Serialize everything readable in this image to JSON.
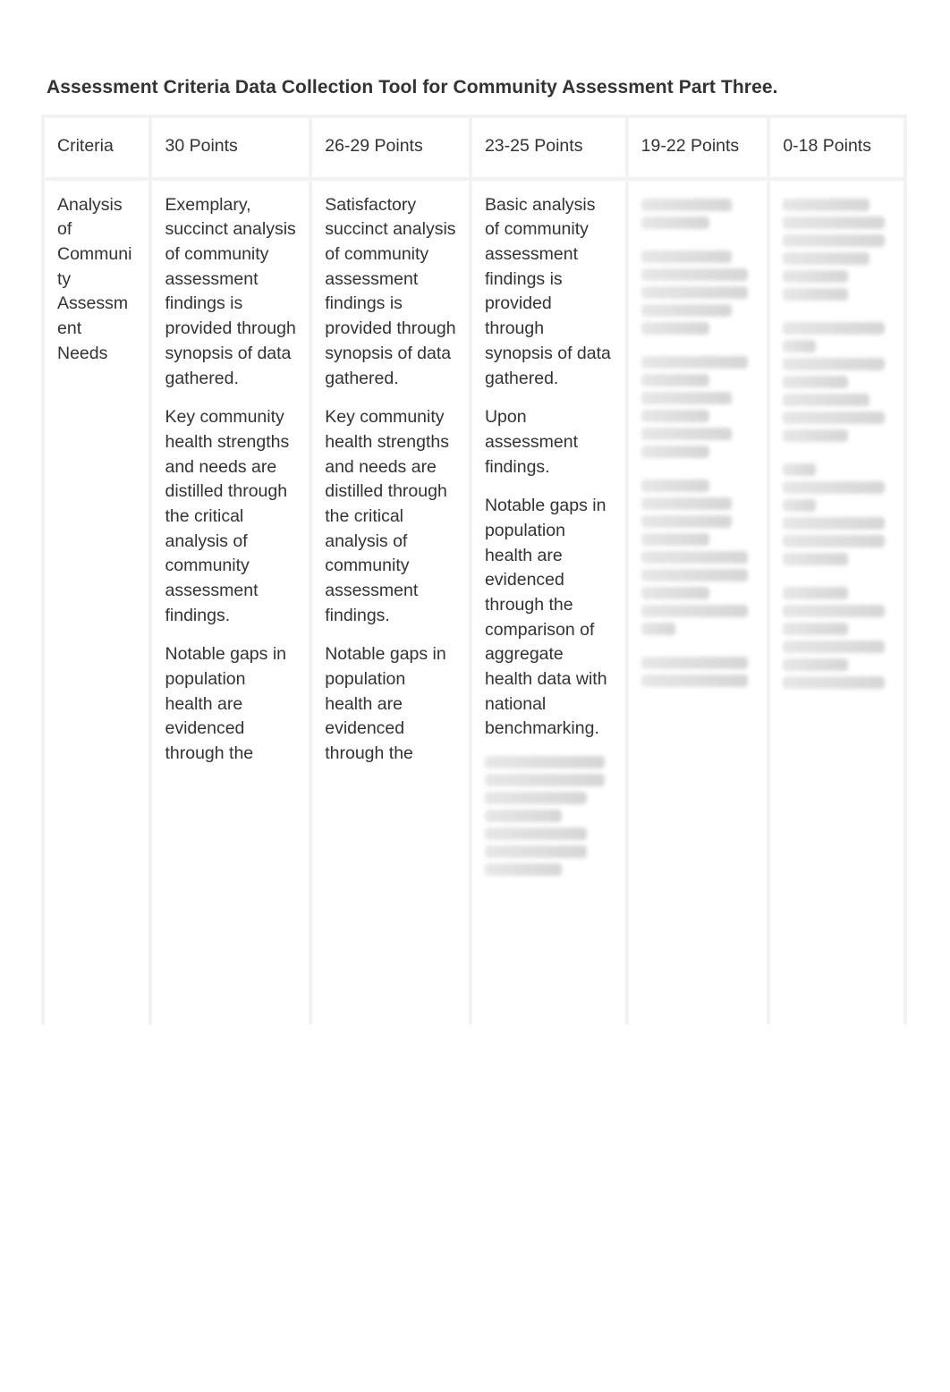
{
  "title": "Assessment Criteria  Data Collection Tool for Community Assessment Part Three.",
  "header": {
    "criteria": "Criteria",
    "col30": "30 Points",
    "col26_29": "26-29 Points",
    "col23_25": "23-25 Points",
    "col19_22": "19-22 Points",
    "col0_18": "0-18 Points"
  },
  "row": {
    "criteria": "Analysis of Community Assessment Needs",
    "col30": [
      "Exemplary, succinct analysis of community assessment findings is provided through synopsis of data gathered.",
      "Key community health strengths and needs are distilled through the critical analysis of community assessment findings.",
      "Notable gaps in population health are evidenced through the"
    ],
    "col26_29": [
      "Satisfactory succinct analysis of community assessment findings is provided through synopsis of data gathered.",
      "Key community health strengths and needs are distilled through the critical analysis of community assessment findings.",
      "Notable gaps in population health are evidenced through the"
    ],
    "col23_25": [
      "Basic analysis of community assessment findings is provided through synopsis of data gathered.",
      "Upon assessment findings.",
      "Notable gaps in population health are evidenced through the comparison of aggregate health data with national benchmarking."
    ]
  }
}
